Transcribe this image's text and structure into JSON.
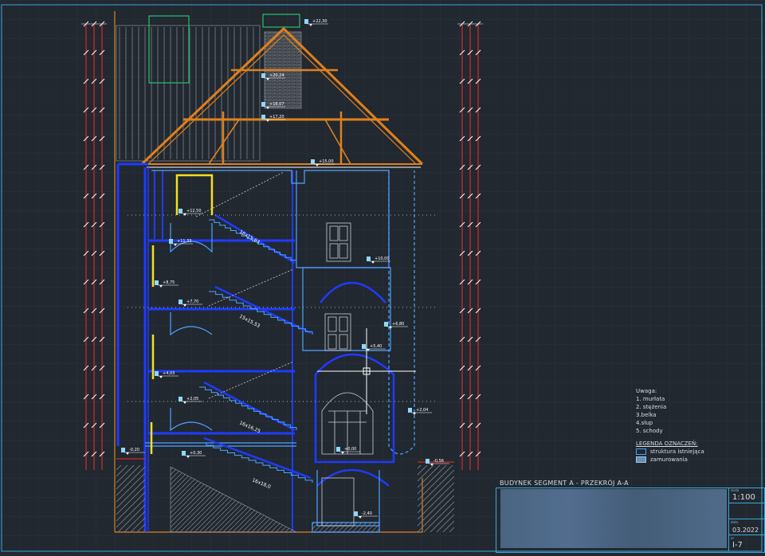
{
  "drawing": {
    "title": "BUDYNEK SEGMENT A - PRZEKRÓJ A-A",
    "scale": "1:100",
    "date": "03.2022",
    "sheet": "I-7"
  },
  "notes": {
    "heading": "Uwaga:",
    "items": [
      "1. murłata",
      "2. stężenia",
      "3.belka",
      "4.słup",
      "5. schody"
    ]
  },
  "legend": {
    "heading": "LEGENDA OZNACZEŃ:",
    "items": [
      {
        "label": "struktura istniejąca",
        "color": "#4fa3ff"
      },
      {
        "label": "zamurowania",
        "color": "#6b8fb3"
      }
    ]
  },
  "levels": [
    "+22,30",
    "+20,24",
    "+18,07",
    "+17,20",
    "+15,00",
    "+12,50",
    "+11,33",
    "+10,00",
    "+8,75",
    "+7,70",
    "+6,80",
    "+5,40",
    "+4,03",
    "+2,05",
    "+2,04",
    "+0,00",
    "+0,30",
    "-0,20",
    "-0,56",
    "-2,40"
  ],
  "stair_labels": [
    "16x15,63",
    "15x15,53",
    "16x16,25",
    "16x18,0"
  ],
  "colors": {
    "wall": "#1f3bff",
    "roof": "#e0801c",
    "existing": "#4fa3ff",
    "dim": "#ff2626",
    "grid": "#2c353f"
  }
}
